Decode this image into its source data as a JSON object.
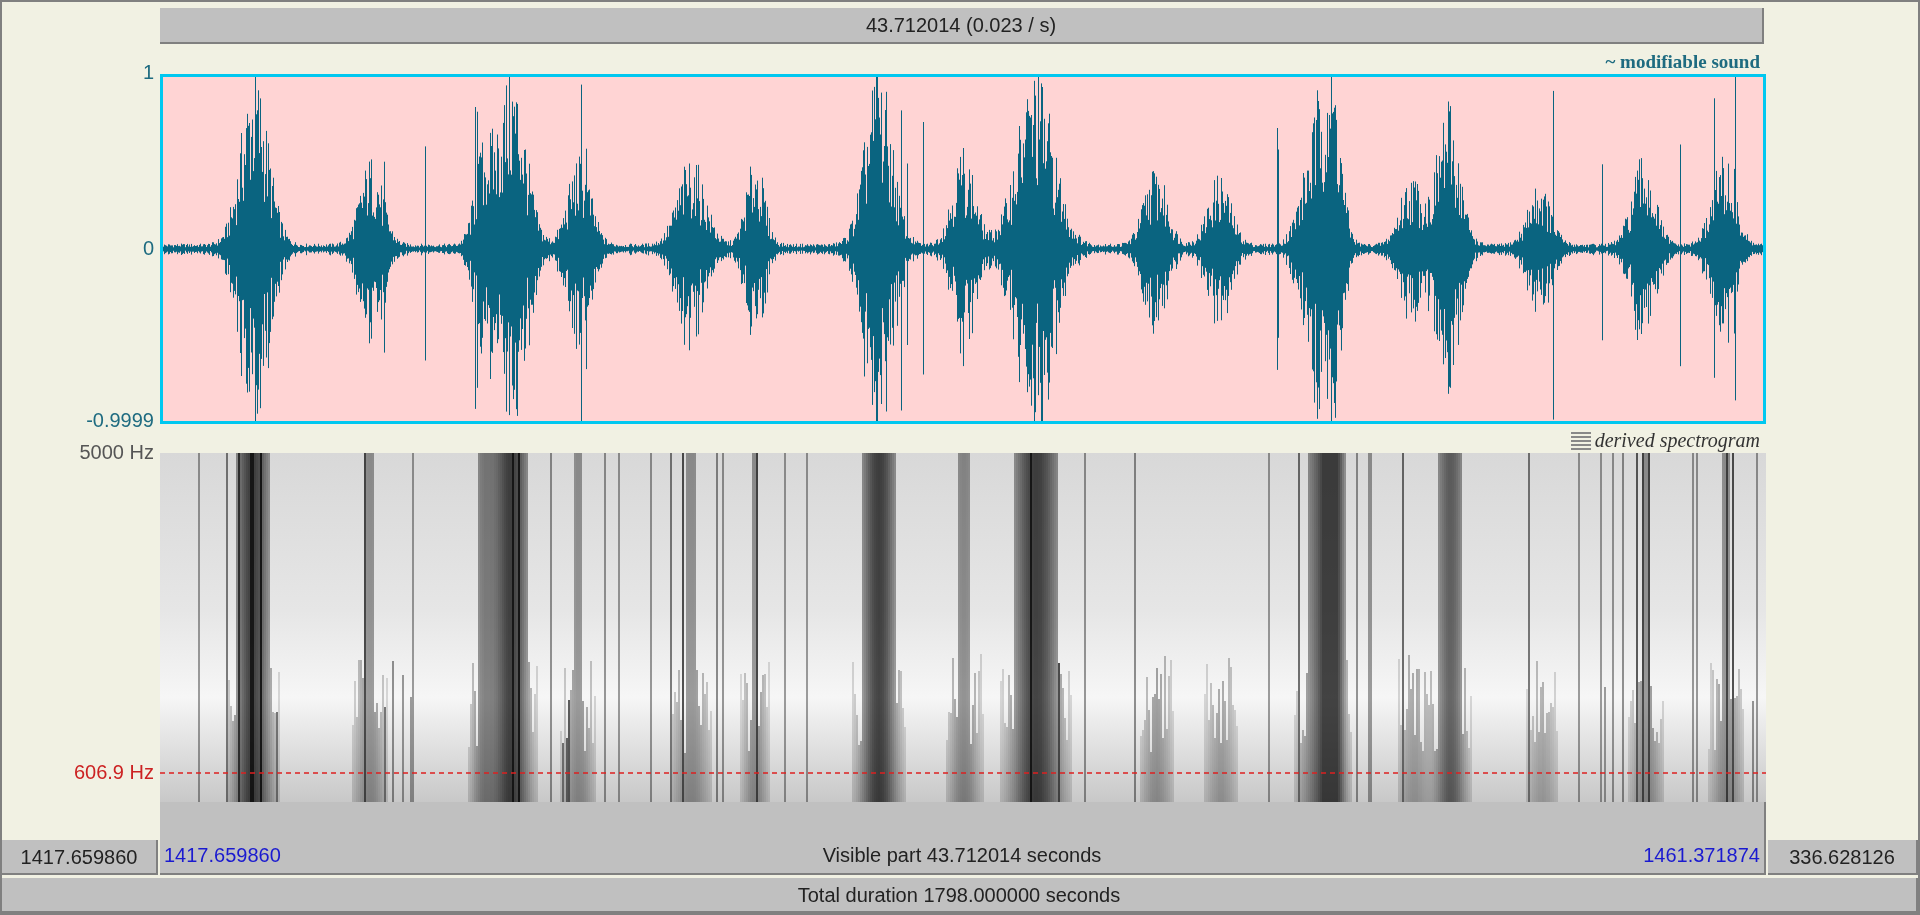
{
  "selection_bar": "43.712014 (0.023 / s)",
  "sound_panel": {
    "label": "~ modifiable sound",
    "y_max": "1",
    "y_zero": "0",
    "y_min": "-0.9999"
  },
  "spectrogram_panel": {
    "label": "derived spectrogram",
    "y_max": "5000 Hz",
    "cursor_frequency": "606.9 Hz"
  },
  "time_bar": {
    "start": "1417.659860",
    "visible_part": "Visible part 43.712014 seconds",
    "end": "1461.371874"
  },
  "before_visible": "1417.659860",
  "after_visible": "336.628126",
  "total_duration": "Total duration 1798.000000 seconds"
}
